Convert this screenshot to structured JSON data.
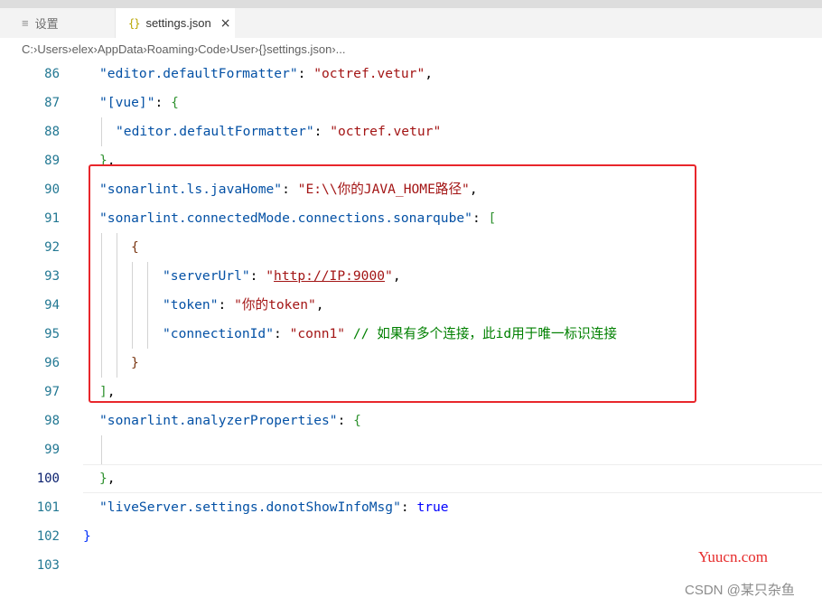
{
  "tabs": [
    {
      "label": "设置",
      "icon": "list-icon"
    },
    {
      "label": "settings.json",
      "icon": "json-braces-icon",
      "close": "×"
    }
  ],
  "breadcrumb": {
    "parts": [
      "C:",
      "Users",
      "elex",
      "AppData",
      "Roaming",
      "Code",
      "User"
    ],
    "file_icon": "{}",
    "file": "settings.json",
    "trailing": "...",
    "separator": "›"
  },
  "editor": {
    "active_line": 100,
    "lines": [
      {
        "n": "86",
        "tokens": [
          [
            "key",
            "\"editor.defaultFormatter\""
          ],
          [
            "pun",
            ": "
          ],
          [
            "str",
            "\"octref.vetur\""
          ],
          [
            "pun",
            ","
          ]
        ]
      },
      {
        "n": "87",
        "tokens": [
          [
            "key",
            "\"[vue]\""
          ],
          [
            "pun",
            ": "
          ],
          [
            "br2",
            "{"
          ]
        ]
      },
      {
        "n": "88",
        "tokens": [
          [
            "key",
            "\"editor.defaultFormatter\""
          ],
          [
            "pun",
            ": "
          ],
          [
            "str",
            "\"octref.vetur\""
          ]
        ]
      },
      {
        "n": "89",
        "tokens": [
          [
            "br2",
            "}"
          ],
          [
            "pun",
            ","
          ]
        ]
      },
      {
        "n": "90",
        "tokens": [
          [
            "key",
            "\"sonarlint.ls.javaHome\""
          ],
          [
            "pun",
            ": "
          ],
          [
            "str",
            "\"E:\\\\你的JAVA_HOME路径\""
          ],
          [
            "pun",
            ","
          ]
        ]
      },
      {
        "n": "91",
        "tokens": [
          [
            "key",
            "\"sonarlint.connectedMode.connections.sonarqube\""
          ],
          [
            "pun",
            ": "
          ],
          [
            "br2",
            "["
          ]
        ]
      },
      {
        "n": "92",
        "tokens": [
          [
            "br3",
            "{"
          ]
        ]
      },
      {
        "n": "93",
        "tokens": [
          [
            "key",
            "\"serverUrl\""
          ],
          [
            "pun",
            ": "
          ],
          [
            "str",
            "\""
          ],
          [
            "strlink",
            "http://IP:9000"
          ],
          [
            "str",
            "\""
          ],
          [
            "pun",
            ","
          ]
        ]
      },
      {
        "n": "94",
        "tokens": [
          [
            "key",
            "\"token\""
          ],
          [
            "pun",
            ": "
          ],
          [
            "str",
            "\"你的token\""
          ],
          [
            "pun",
            ","
          ]
        ]
      },
      {
        "n": "95",
        "tokens": [
          [
            "key",
            "\"connectionId\""
          ],
          [
            "pun",
            ": "
          ],
          [
            "str",
            "\"conn1\""
          ],
          [
            "pun",
            " "
          ],
          [
            "com",
            "// 如果有多个连接，此id用于唯一标识连接"
          ]
        ]
      },
      {
        "n": "96",
        "tokens": [
          [
            "br3",
            "}"
          ]
        ]
      },
      {
        "n": "97",
        "tokens": [
          [
            "br2",
            "]"
          ],
          [
            "pun",
            ","
          ]
        ]
      },
      {
        "n": "98",
        "tokens": [
          [
            "key",
            "\"sonarlint.analyzerProperties\""
          ],
          [
            "pun",
            ": "
          ],
          [
            "br2",
            "{"
          ]
        ]
      },
      {
        "n": "99",
        "tokens": []
      },
      {
        "n": "100",
        "tokens": [
          [
            "br2",
            "}"
          ],
          [
            "pun",
            ","
          ]
        ]
      },
      {
        "n": "101",
        "tokens": [
          [
            "key",
            "\"liveServer.settings.donotShowInfoMsg\""
          ],
          [
            "pun",
            ": "
          ],
          [
            "kw",
            "true"
          ]
        ]
      },
      {
        "n": "102",
        "tokens": [
          [
            "br1",
            "}"
          ]
        ]
      },
      {
        "n": "103",
        "tokens": []
      }
    ]
  },
  "watermarks": {
    "site": "Yuucn.com",
    "author": "CSDN @某只杂鱼"
  },
  "colors": {
    "highlight_box": "#e8262b",
    "line_number": "#237893",
    "key": "#0451a5",
    "string": "#a31515"
  }
}
